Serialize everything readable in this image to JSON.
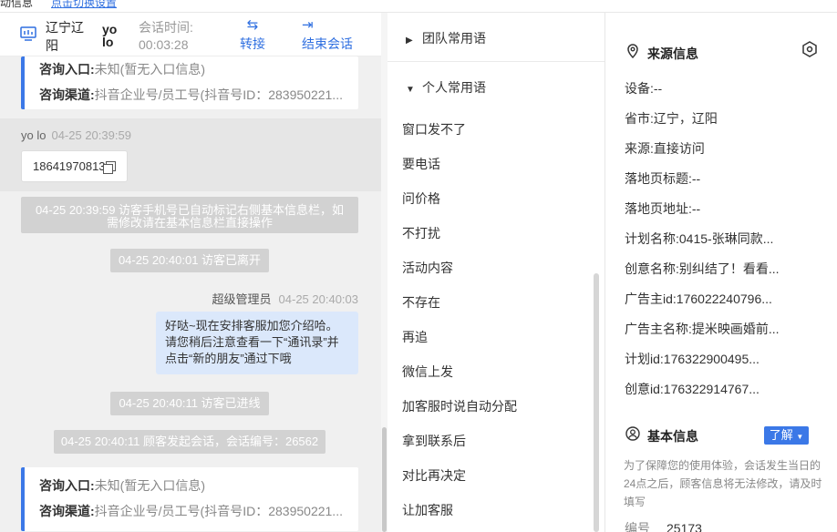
{
  "top_strip": {
    "left_text": "动信息",
    "link_text": "点击切换设置"
  },
  "chat": {
    "header": {
      "location": "辽宁辽阳",
      "user": "yo lo",
      "session_label": "会话时间:",
      "session_value": "00:03:28",
      "transfer_label": "转接",
      "end_label": "结束会话"
    },
    "card_top": {
      "entry_label": "咨询入口:",
      "entry_value": "未知(暂无入口信息)",
      "channel_label": "咨询渠道:",
      "channel_value": "抖音企业号/员工号(抖音号ID：283950221..."
    },
    "user_message": {
      "name": "yo lo",
      "time": "04-25 20:39:59",
      "text": "18641970813"
    },
    "sys1": "04-25 20:39:59 访客手机号已自动标记右侧基本信息栏，如需修改请在基本信息栏直接操作",
    "sys2": "04-25 20:40:01 访客已离开",
    "admin_message": {
      "name": "超级管理员",
      "time": "04-25 20:40:03",
      "text": "好哒~现在安排客服加您介绍哈。请您稍后注意查看一下“通讯录”并点击“新的朋友”通过下哦"
    },
    "sys3": "04-25 20:40:11 访客已进线",
    "sys4": "04-25 20:40:11 顾客发起会话，会话编号：26562",
    "card_bottom": {
      "entry_label": "咨询入口:",
      "entry_value": "未知(暂无入口信息)",
      "channel_label": "咨询渠道:",
      "channel_value": "抖音企业号/员工号(抖音号ID：283950221..."
    }
  },
  "phrases": {
    "team_group": "团队常用语",
    "personal_group": "个人常用语",
    "items": [
      "窗口发不了",
      "要电话",
      "问价格",
      "不打扰",
      "活动内容",
      "不存在",
      "再追",
      "微信上发",
      "加客服时说自动分配",
      "拿到联系后",
      "对比再决定",
      "让加客服"
    ]
  },
  "info": {
    "source_title": "来源信息",
    "source_fields": [
      {
        "label": "设备:",
        "value": "--"
      },
      {
        "label": "省市:",
        "value": "辽宁，辽阳"
      },
      {
        "label": "来源:",
        "value": "直接访问"
      },
      {
        "label": "落地页标题:",
        "value": "--"
      },
      {
        "label": "落地页地址:",
        "value": "--"
      },
      {
        "label": "计划名称:",
        "value": "0415-张琳同款..."
      },
      {
        "label": "创意名称:",
        "value": "别纠结了！看看..."
      },
      {
        "label": "广告主id:",
        "value": "176022240796..."
      },
      {
        "label": "广告主名称:",
        "value": "提米映画婚前..."
      },
      {
        "label": "计划id:",
        "value": "176322900495..."
      },
      {
        "label": "创意id:",
        "value": "176322914767..."
      }
    ],
    "basic_title": "基本信息",
    "learn_label": "了解",
    "notice": "为了保障您的使用体验，会话发生当日的24点之后，顾客信息将无法修改，请及时填写",
    "id_label": "编号",
    "id_value": "25173"
  },
  "colors": {
    "accent": "#3b78e7",
    "admin_bubble": "#dbe8fb",
    "system_bar": "#d2d2d2"
  }
}
